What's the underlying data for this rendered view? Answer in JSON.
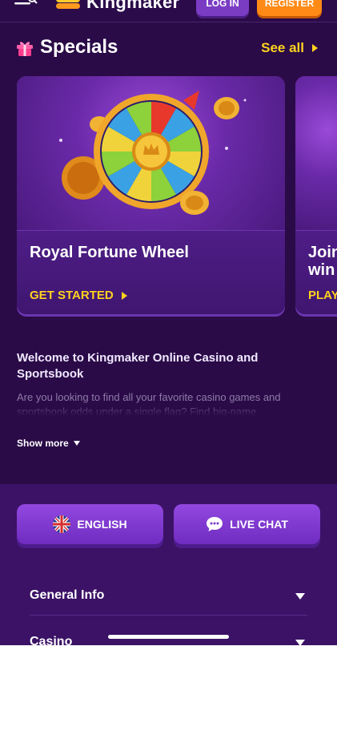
{
  "header": {
    "brand": "Kingmaker",
    "login_label": "LOG IN",
    "register_label": "REGISTER",
    "menu_icon": "menu-search-icon"
  },
  "specials": {
    "title": "Specials",
    "see_all_label": "See all",
    "cards": [
      {
        "title": "Royal Fortune Wheel",
        "cta": "GET STARTED"
      },
      {
        "title": "Join\nwin",
        "cta": "PLAY"
      }
    ]
  },
  "welcome": {
    "title": "Welcome to Kingmaker Online Casino and Sportsbook",
    "text": "Are you looking to find all your favorite casino games and sportsbook odds under a single flag? Find big-name",
    "show_more_label": "Show more"
  },
  "footer": {
    "language_label": "ENGLISH",
    "live_chat_label": "LIVE CHAT",
    "accordion": [
      {
        "label": "General Info"
      },
      {
        "label": "Casino"
      }
    ]
  },
  "colors": {
    "background": "#2a0b47",
    "accent_yellow": "#ffd21f",
    "register_orange": "#ff8a16",
    "purple_button": "#7b3cc4"
  }
}
